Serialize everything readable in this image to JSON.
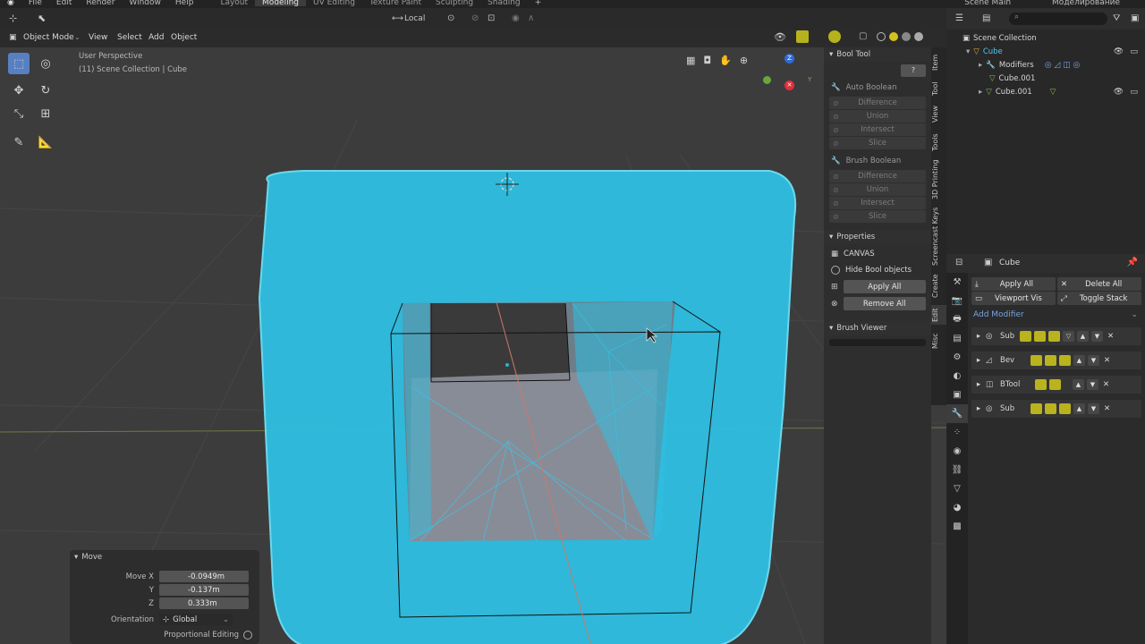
{
  "topbar": {
    "menus": [
      "File",
      "Edit",
      "Render",
      "Window",
      "Help"
    ],
    "workspaces": [
      "Layout",
      "Modeling",
      "UV Editing",
      "Texture Paint",
      "Sculpting",
      "Shading"
    ],
    "active_workspace": "Modeling",
    "add_tab": "+",
    "scene": "Scene Main",
    "view_layer": "Моделирование"
  },
  "header": {
    "transform_orientation": "Local",
    "mode": "Object Mode",
    "menu": [
      "View",
      "Select",
      "Add",
      "Object"
    ]
  },
  "viewport": {
    "perspective": "User Perspective",
    "collection_info": "(11) Scene Collection | Cube",
    "gizmo_axes": {
      "z": "Z",
      "y": "Y"
    }
  },
  "sidebar_tabs": [
    "Item",
    "Tool",
    "View",
    "Tools",
    "3D Printing",
    "Screencast Keys",
    "Create",
    "Edit",
    "Misc"
  ],
  "bool_tool": {
    "title": "Bool Tool",
    "help": "?",
    "auto_boolean": "Auto Boolean",
    "auto_ops": [
      "Difference",
      "Union",
      "Intersect",
      "Slice"
    ],
    "brush_boolean": "Brush Boolean",
    "brush_ops": [
      "Difference",
      "Union",
      "Intersect",
      "Slice"
    ],
    "properties_title": "Properties",
    "canvas_label": "CANVAS",
    "hide_bool_objects": "Hide Bool objects",
    "apply_all": "Apply All",
    "remove_all": "Remove All",
    "brush_viewer": "Brush Viewer"
  },
  "outliner": {
    "root": "Scene Collection",
    "items": [
      "Cube",
      "Modifiers",
      "Cube.001",
      "Cube.001"
    ]
  },
  "properties": {
    "object_name": "Cube",
    "apply_all": "Apply All",
    "delete_all": "Delete All",
    "viewport_vis": "Viewport Vis",
    "toggle_stack": "Toggle Stack",
    "add_modifier": "Add Modifier",
    "modifiers": [
      "Sub",
      "Bev",
      "BTool",
      "Sub"
    ]
  },
  "move_panel": {
    "title": "Move",
    "move_x_label": "Move X",
    "move_x": "-0.0949m",
    "y_label": "Y",
    "y": "-0.137m",
    "z_label": "Z",
    "z": "0.333m",
    "orientation_label": "Orientation",
    "orientation": "Global",
    "proportional_editing": "Proportional Editing"
  },
  "colors": {
    "accent": "#5680c2",
    "selection_cyan": "#2fc4e8",
    "modifier_toggle": "#b9b31d",
    "viewport_bg": "#3c3c3c"
  }
}
